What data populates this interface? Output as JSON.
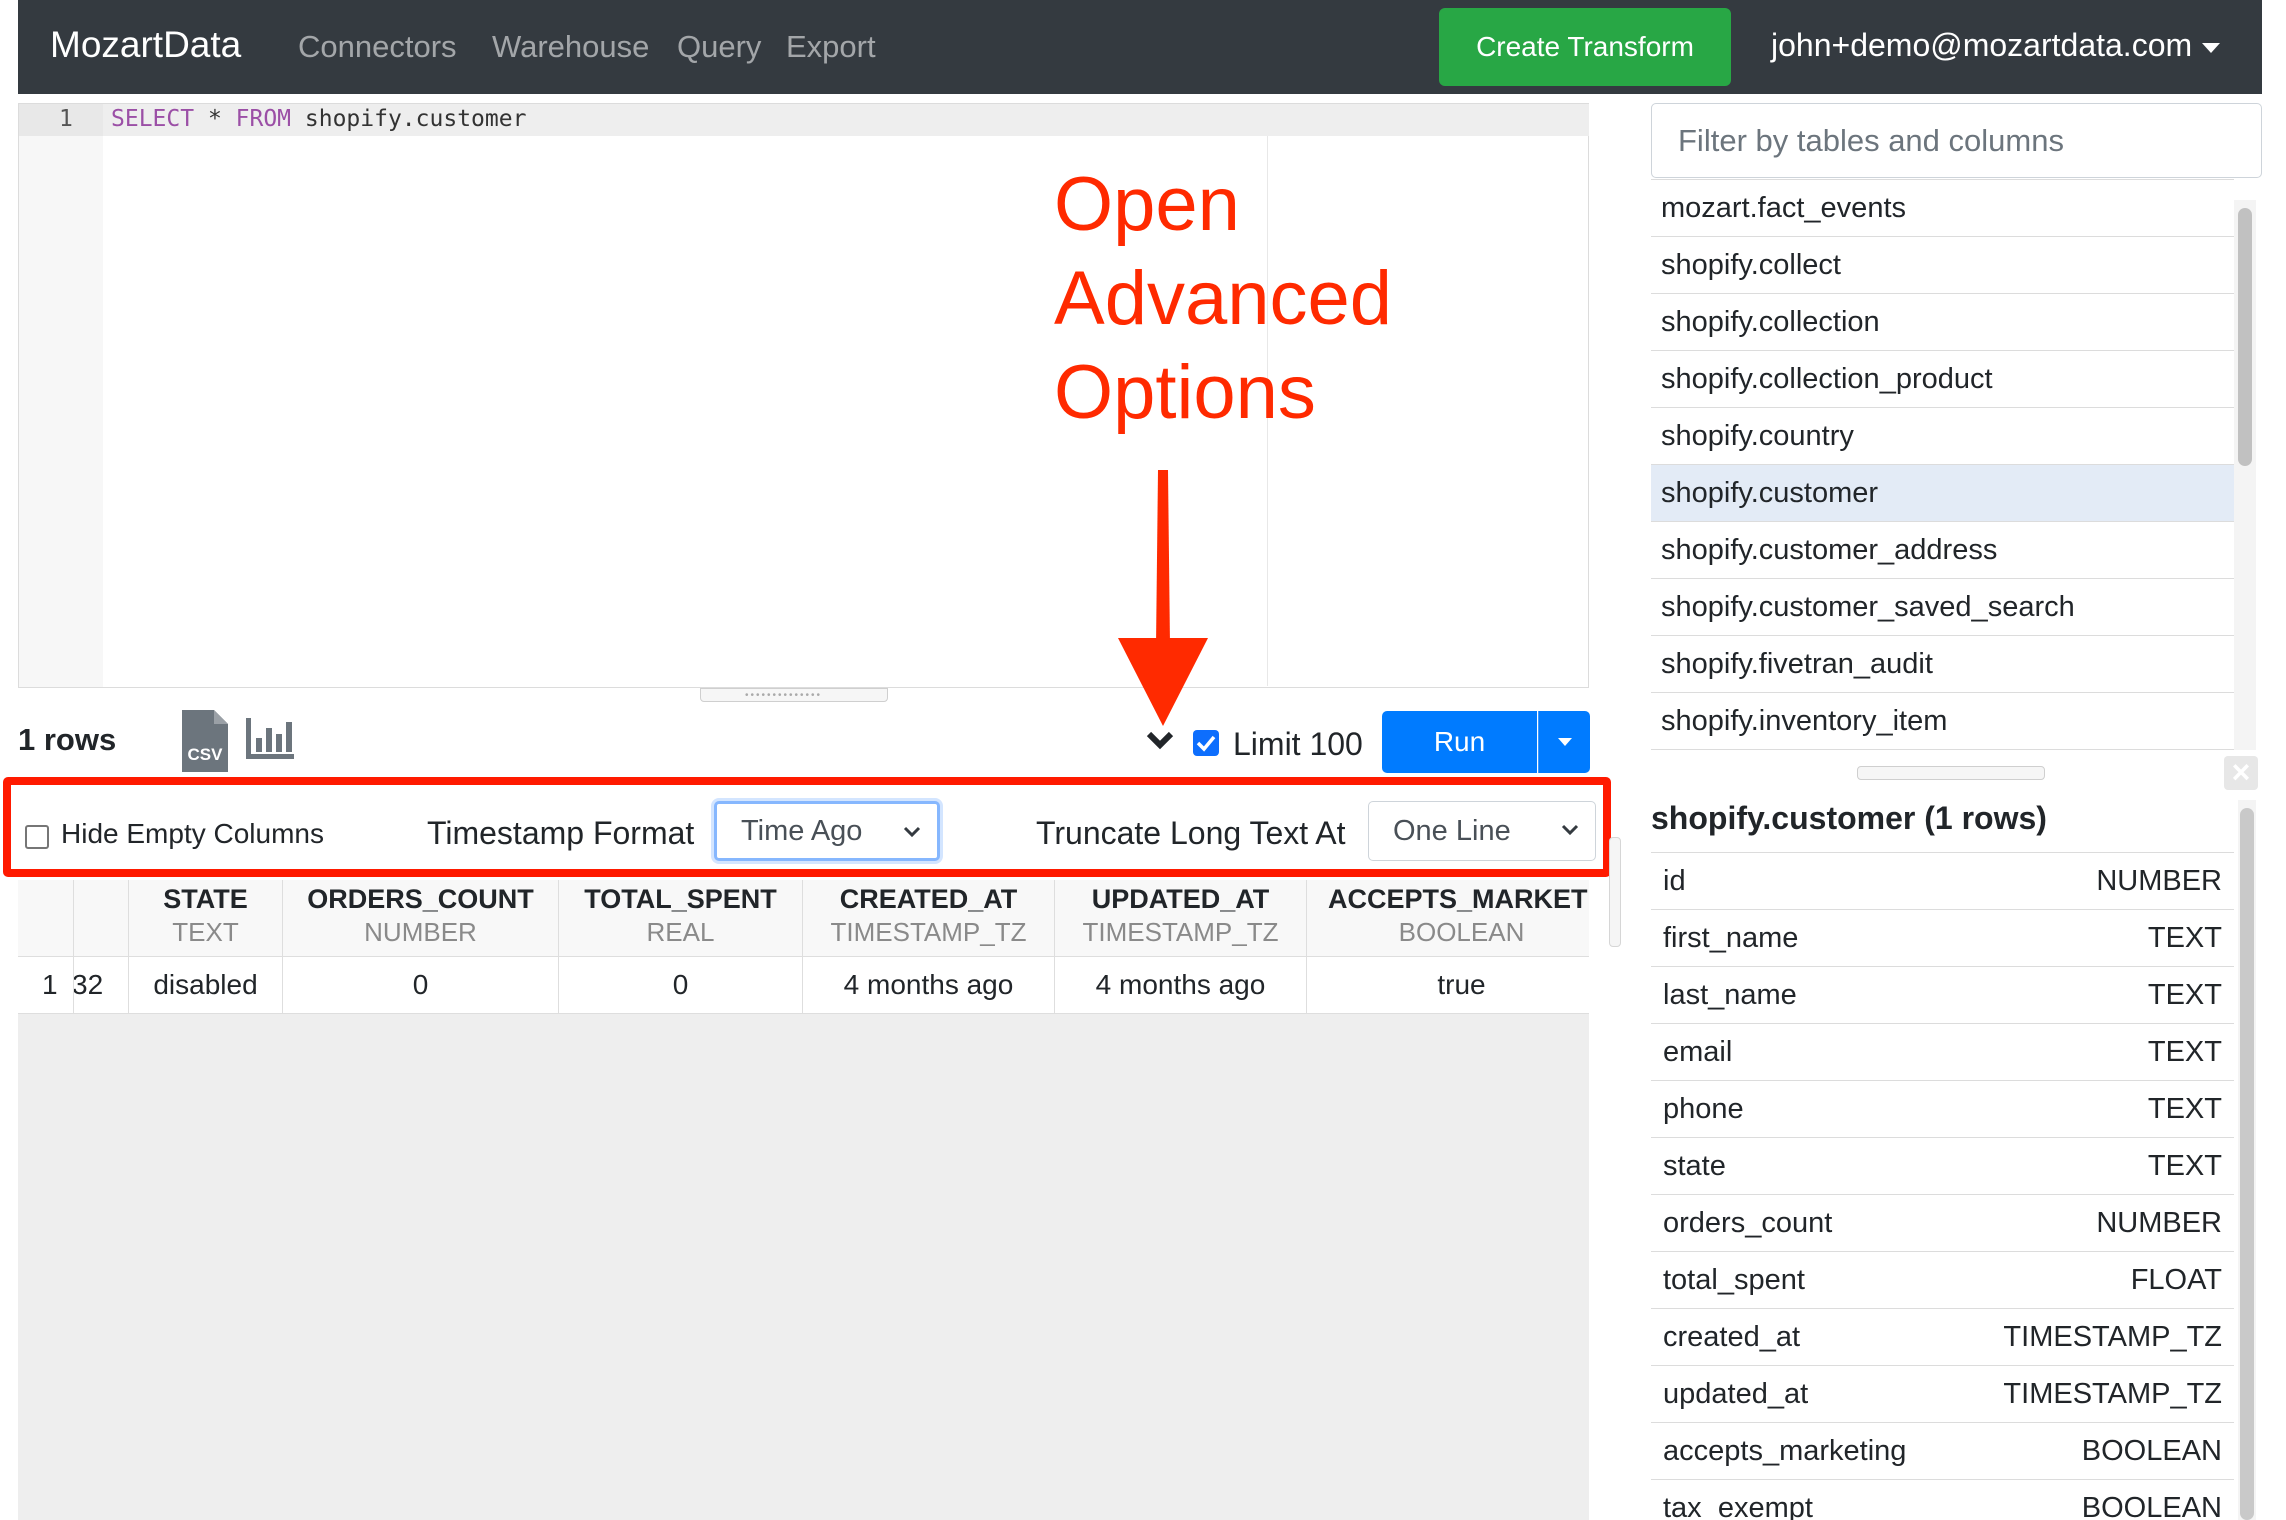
{
  "navbar": {
    "brand": "MozartData",
    "links": [
      "Connectors",
      "Warehouse",
      "Query",
      "Export"
    ],
    "create_button": "Create Transform",
    "user_email": "john+demo@mozartdata.com"
  },
  "editor": {
    "line_number": "1",
    "keyword_select": "SELECT",
    "star": " * ",
    "keyword_from": "FROM",
    "table_ref": " shopify.customer"
  },
  "annotation": {
    "lines": [
      "Open",
      "Advanced",
      "Options"
    ],
    "color": "#ff2a00"
  },
  "toolbar": {
    "rows_count": "1 rows",
    "csv_label": "CSV",
    "limit_checked": true,
    "limit_label": "Limit 100",
    "run_label": "Run"
  },
  "advanced_options": {
    "hide_empty_columns_label": "Hide Empty Columns",
    "hide_empty_columns_checked": false,
    "timestamp_format_label": "Timestamp Format",
    "timestamp_format_value": "Time Ago",
    "truncate_label": "Truncate Long Text At",
    "truncate_value": "One Line"
  },
  "results": {
    "columns": [
      {
        "name": "",
        "type": ""
      },
      {
        "name": "STATE",
        "type": "TEXT"
      },
      {
        "name": "ORDERS_COUNT",
        "type": "NUMBER"
      },
      {
        "name": "TOTAL_SPENT",
        "type": "REAL"
      },
      {
        "name": "CREATED_AT",
        "type": "TIMESTAMP_TZ"
      },
      {
        "name": "UPDATED_AT",
        "type": "TIMESTAMP_TZ"
      },
      {
        "name": "ACCEPTS_MARKETI",
        "type": "BOOLEAN"
      }
    ],
    "row": {
      "index": "1",
      "partial": "32",
      "values": [
        "disabled",
        "0",
        "0",
        "4 months ago",
        "4 months ago",
        "true"
      ]
    }
  },
  "right_panel": {
    "filter_placeholder": "Filter by tables and columns",
    "tables": [
      "mozart.fact_events",
      "shopify.collect",
      "shopify.collection",
      "shopify.collection_product",
      "shopify.country",
      "shopify.customer",
      "shopify.customer_address",
      "shopify.customer_saved_search",
      "shopify.fivetran_audit",
      "shopify.inventory_item"
    ],
    "active_table": "shopify.customer",
    "schema_title": "shopify.customer (1 rows)",
    "schema": [
      {
        "column": "id",
        "type": "NUMBER"
      },
      {
        "column": "first_name",
        "type": "TEXT"
      },
      {
        "column": "last_name",
        "type": "TEXT"
      },
      {
        "column": "email",
        "type": "TEXT"
      },
      {
        "column": "phone",
        "type": "TEXT"
      },
      {
        "column": "state",
        "type": "TEXT"
      },
      {
        "column": "orders_count",
        "type": "NUMBER"
      },
      {
        "column": "total_spent",
        "type": "FLOAT"
      },
      {
        "column": "created_at",
        "type": "TIMESTAMP_TZ"
      },
      {
        "column": "updated_at",
        "type": "TIMESTAMP_TZ"
      },
      {
        "column": "accepts_marketing",
        "type": "BOOLEAN"
      },
      {
        "column": "tax_exempt",
        "type": "BOOLEAN"
      }
    ]
  }
}
